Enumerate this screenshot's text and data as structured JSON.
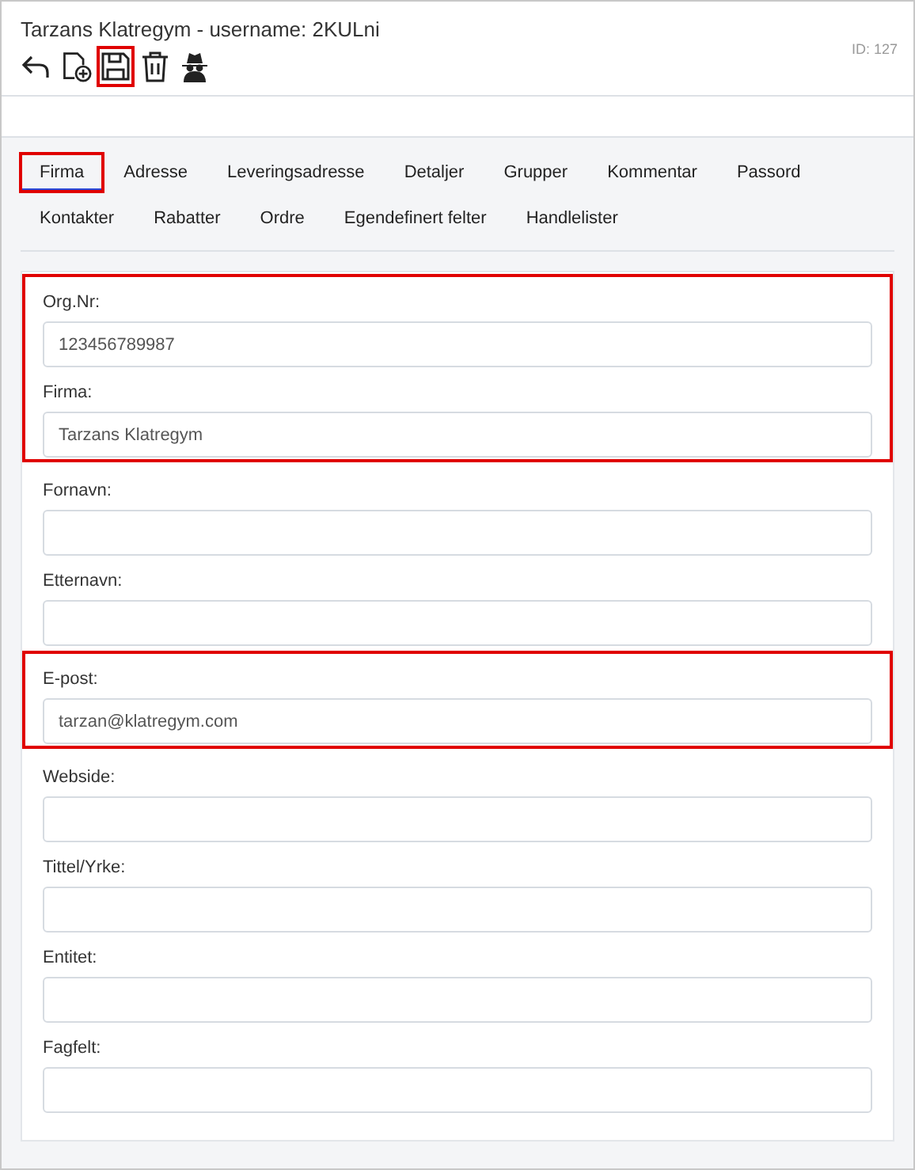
{
  "header": {
    "title": "Tarzans Klatregym - username: 2KULni",
    "id_label": "ID: 127",
    "toolbar": [
      {
        "kind": "back",
        "highlighted": false
      },
      {
        "kind": "new-document",
        "highlighted": false
      },
      {
        "kind": "save",
        "highlighted": true
      },
      {
        "kind": "delete",
        "highlighted": false
      },
      {
        "kind": "incognito",
        "highlighted": false
      }
    ]
  },
  "tabs": [
    [
      {
        "label": "Firma",
        "selected": true,
        "highlighted": true
      },
      {
        "label": "Adresse",
        "selected": false,
        "highlighted": false
      },
      {
        "label": "Leveringsadresse",
        "selected": false,
        "highlighted": false
      },
      {
        "label": "Detaljer",
        "selected": false,
        "highlighted": false
      },
      {
        "label": "Grupper",
        "selected": false,
        "highlighted": false
      },
      {
        "label": "Kommentar",
        "selected": false,
        "highlighted": false
      },
      {
        "label": "Passord",
        "selected": false,
        "highlighted": false
      }
    ],
    [
      {
        "label": "Kontakter",
        "selected": false,
        "highlighted": false
      },
      {
        "label": "Rabatter",
        "selected": false,
        "highlighted": false
      },
      {
        "label": "Ordre",
        "selected": false,
        "highlighted": false
      },
      {
        "label": "Egendefinert felter",
        "selected": false,
        "highlighted": false
      },
      {
        "label": "Handlelister",
        "selected": false,
        "highlighted": false
      }
    ]
  ],
  "form": {
    "sections": [
      {
        "highlighted": true,
        "fields": [
          {
            "label": "Org.Nr:",
            "value": "123456789987"
          },
          {
            "label": "Firma:",
            "value": "Tarzans Klatregym"
          }
        ]
      },
      {
        "highlighted": false,
        "fields": [
          {
            "label": "Fornavn:"
          },
          {
            "label": "Etternavn:"
          }
        ]
      },
      {
        "highlighted": true,
        "fields": [
          {
            "label": "E-post:",
            "value": "tarzan@klatregym.com"
          }
        ]
      },
      {
        "highlighted": false,
        "fields": [
          {
            "label": "Webside:"
          },
          {
            "label": "Tittel/Yrke:"
          },
          {
            "label": "Entitet:"
          },
          {
            "label": "Fagfelt:"
          }
        ]
      }
    ]
  }
}
